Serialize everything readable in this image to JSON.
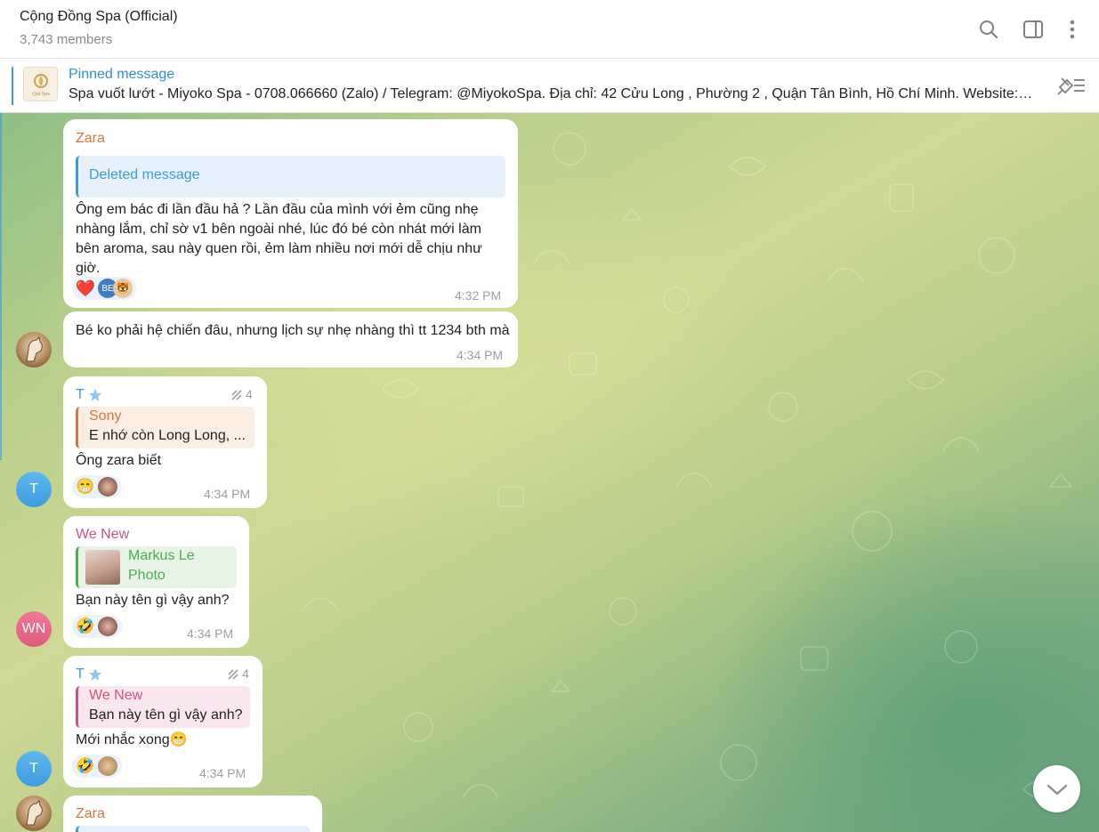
{
  "header": {
    "title": "Cộng Đồng Spa (Official)",
    "members": "3,743 members"
  },
  "pinned": {
    "label": "Pinned message",
    "text": "Spa vuốt lướt  - Miyoko Spa - 0708.066660 (Zalo) / Telegram: @MiyokoSpa.  Địa chỉ: 42 Cửu Long , Phường 2 , Quận Tân Bình, Hồ Chí Minh. Website: miyokospa.com",
    "thumb_text": "Qui Spa"
  },
  "messages": [
    {
      "sender": "Zara",
      "quote_text": "Deleted message",
      "text": "Ông em bác đi lần đầu hả ? Lần đầu của mình với ẻm cũng nhẹ nhàng lắm, chỉ sờ v1 bên ngoài nhé, lúc đó bé còn nhát mới làm bên aroma, sau này quen rồi, ẻm làm nhiều nơi mới dễ chịu như giờ.",
      "reactions": [
        "❤️",
        "BE",
        "🐯"
      ],
      "time": "4:32 PM"
    },
    {
      "text": "Bé ko phải hệ chiến đâu, nhưng lịch sự nhẹ nhàng thì tt 1234 bth mà",
      "time": "4:34 PM"
    },
    {
      "sender": "T",
      "views": "4",
      "quote_name": "Sony",
      "quote_text": "E nhớ còn Long Long, ...",
      "text": "Ông zara biết",
      "reactions": [
        "😁"
      ],
      "time": "4:34 PM",
      "avatar": "T"
    },
    {
      "sender": "We New",
      "quote_name": "Markus Le",
      "quote_text": "Photo",
      "text": "Bạn này tên gì vậy anh?",
      "reactions": [
        "🤣"
      ],
      "time": "4:34 PM",
      "avatar": "WN"
    },
    {
      "sender": "T",
      "views": "4",
      "quote_name": "We New",
      "quote_text": "Bạn này tên gì vậy anh?",
      "text": "Mới nhắc xong😁",
      "reactions": [
        "🤣"
      ],
      "time": "4:34 PM",
      "avatar": "T"
    },
    {
      "sender": "Zara"
    }
  ],
  "colors": {
    "accent": "#3a9be0",
    "zara": "#d2763d",
    "wenew": "#cc5580",
    "markus": "#4caf50",
    "sony": "#d2763d"
  }
}
